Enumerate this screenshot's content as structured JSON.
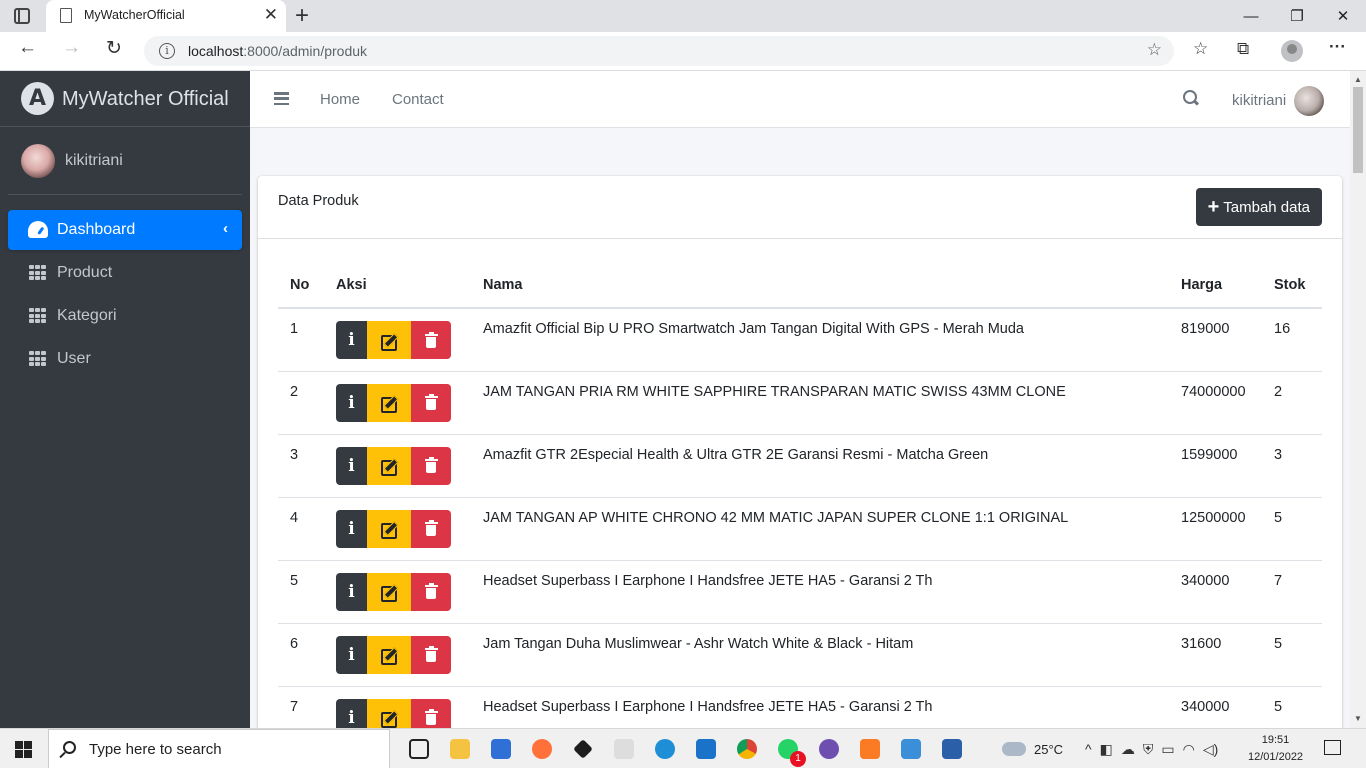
{
  "browser": {
    "tab_title": "MyWatcherOfficial",
    "url_host": "localhost",
    "url_path": ":8000/admin/produk"
  },
  "sidebar": {
    "brand": "MyWatcher Official",
    "user_name": "kikitriani",
    "items": [
      {
        "label": "Dashboard",
        "icon": "dashboard-icon",
        "active": true
      },
      {
        "label": "Product",
        "icon": "grid-icon"
      },
      {
        "label": "Kategori",
        "icon": "grid-icon"
      },
      {
        "label": "User",
        "icon": "grid-icon"
      }
    ]
  },
  "topnav": {
    "links": [
      "Home",
      "Contact"
    ],
    "user_name": "kikitriani"
  },
  "card": {
    "title": "Data Produk",
    "add_button": "Tambah data"
  },
  "table": {
    "headers": [
      "No",
      "Aksi",
      "Nama",
      "Harga",
      "Stok"
    ],
    "rows": [
      {
        "no": "1",
        "nama": "Amazfit Official Bip U PRO Smartwatch Jam Tangan Digital With GPS - Merah Muda",
        "harga": "819000",
        "stok": "16"
      },
      {
        "no": "2",
        "nama": "JAM TANGAN PRIA RM WHITE SAPPHIRE TRANSPARAN MATIC SWISS 43MM CLONE",
        "harga": "74000000",
        "stok": "2"
      },
      {
        "no": "3",
        "nama": "Amazfit GTR 2Especial Health & Ultra GTR 2E Garansi Resmi - Matcha Green",
        "harga": "1599000",
        "stok": "3"
      },
      {
        "no": "4",
        "nama": "JAM TANGAN AP WHITE CHRONO 42 MM MATIC JAPAN SUPER CLONE 1:1 ORIGINAL",
        "harga": "12500000",
        "stok": "5"
      },
      {
        "no": "5",
        "nama": "Headset Superbass I Earphone I Handsfree JETE HA5 - Garansi 2 Th",
        "harga": "340000",
        "stok": "7"
      },
      {
        "no": "6",
        "nama": "Jam Tangan Duha Muslimwear - Ashr Watch White & Black - Hitam",
        "harga": "31600",
        "stok": "5"
      },
      {
        "no": "7",
        "nama": "Headset Superbass I Earphone I Handsfree JETE HA5 - Garansi 2 Th",
        "harga": "340000",
        "stok": "5"
      }
    ]
  },
  "taskbar": {
    "search_placeholder": "Type here to search",
    "temperature": "25°C",
    "time": "19:51",
    "date": "12/01/2022",
    "whatsapp_badge": "1"
  },
  "colors": {
    "sidebar_bg": "#343a40",
    "active_blue": "#007bff",
    "edit_yellow": "#ffc107",
    "delete_red": "#dc3545"
  }
}
